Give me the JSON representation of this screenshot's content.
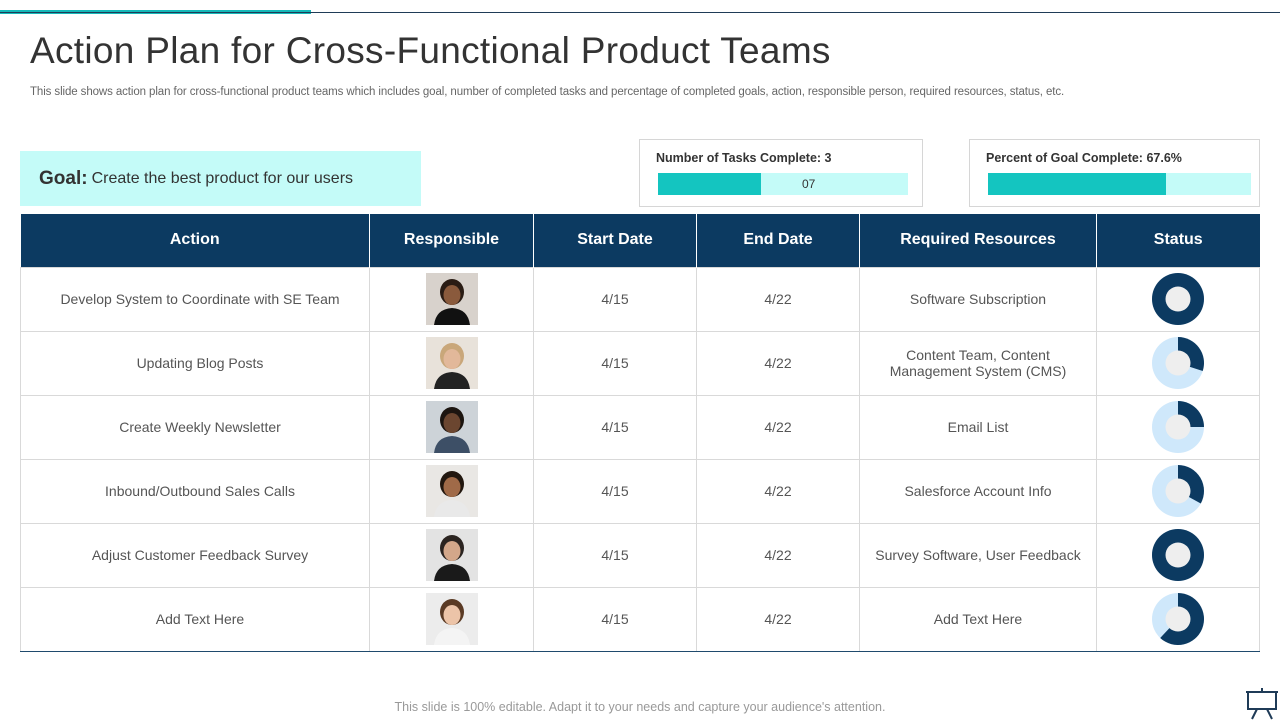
{
  "header": {
    "title": "Action Plan for Cross-Functional Product Teams",
    "subtitle": "This slide shows action plan for cross-functional product teams which includes goal, number of completed tasks and percentage of completed goals, action, responsible person, required resources, status, etc."
  },
  "goal": {
    "label": "Goal:",
    "text": "Create the best product for our users"
  },
  "tasks_kpi": {
    "title": "Number of Tasks Complete: 3",
    "bar_text": "07",
    "fraction": 0.41
  },
  "percent_kpi": {
    "title": "Percent of Goal Complete: 67.6%",
    "fraction": 0.676
  },
  "table": {
    "headers": [
      "Action",
      "Responsible",
      "Start Date",
      "End Date",
      "Required Resources",
      "Status"
    ],
    "rows": [
      {
        "action": "Develop System to Coordinate with SE Team",
        "start": "4/15",
        "end": "4/22",
        "resources": "Software Subscription",
        "status": 1.0
      },
      {
        "action": "Updating Blog Posts",
        "start": "4/15",
        "end": "4/22",
        "resources": "Content Team, Content Management System (CMS)",
        "status": 0.3
      },
      {
        "action": "Create Weekly Newsletter",
        "start": "4/15",
        "end": "4/22",
        "resources": "Email List",
        "status": 0.25
      },
      {
        "action": "Inbound/Outbound Sales Calls",
        "start": "4/15",
        "end": "4/22",
        "resources": "Salesforce Account Info",
        "status": 0.33
      },
      {
        "action": "Adjust Customer Feedback Survey",
        "start": "4/15",
        "end": "4/22",
        "resources": "Survey Software, User Feedback",
        "status": 1.0
      },
      {
        "action": "Add Text Here",
        "start": "4/15",
        "end": "4/22",
        "resources": "Add Text Here",
        "status": 0.62
      }
    ]
  },
  "colors": {
    "navy": "#0c3a61",
    "teal": "#14c5c0",
    "light_teal": "#c4fbf8",
    "light_blue": "#cfe8fb"
  },
  "footer": {
    "text": "This slide is 100% editable. Adapt it to your needs and capture your audience's attention."
  }
}
